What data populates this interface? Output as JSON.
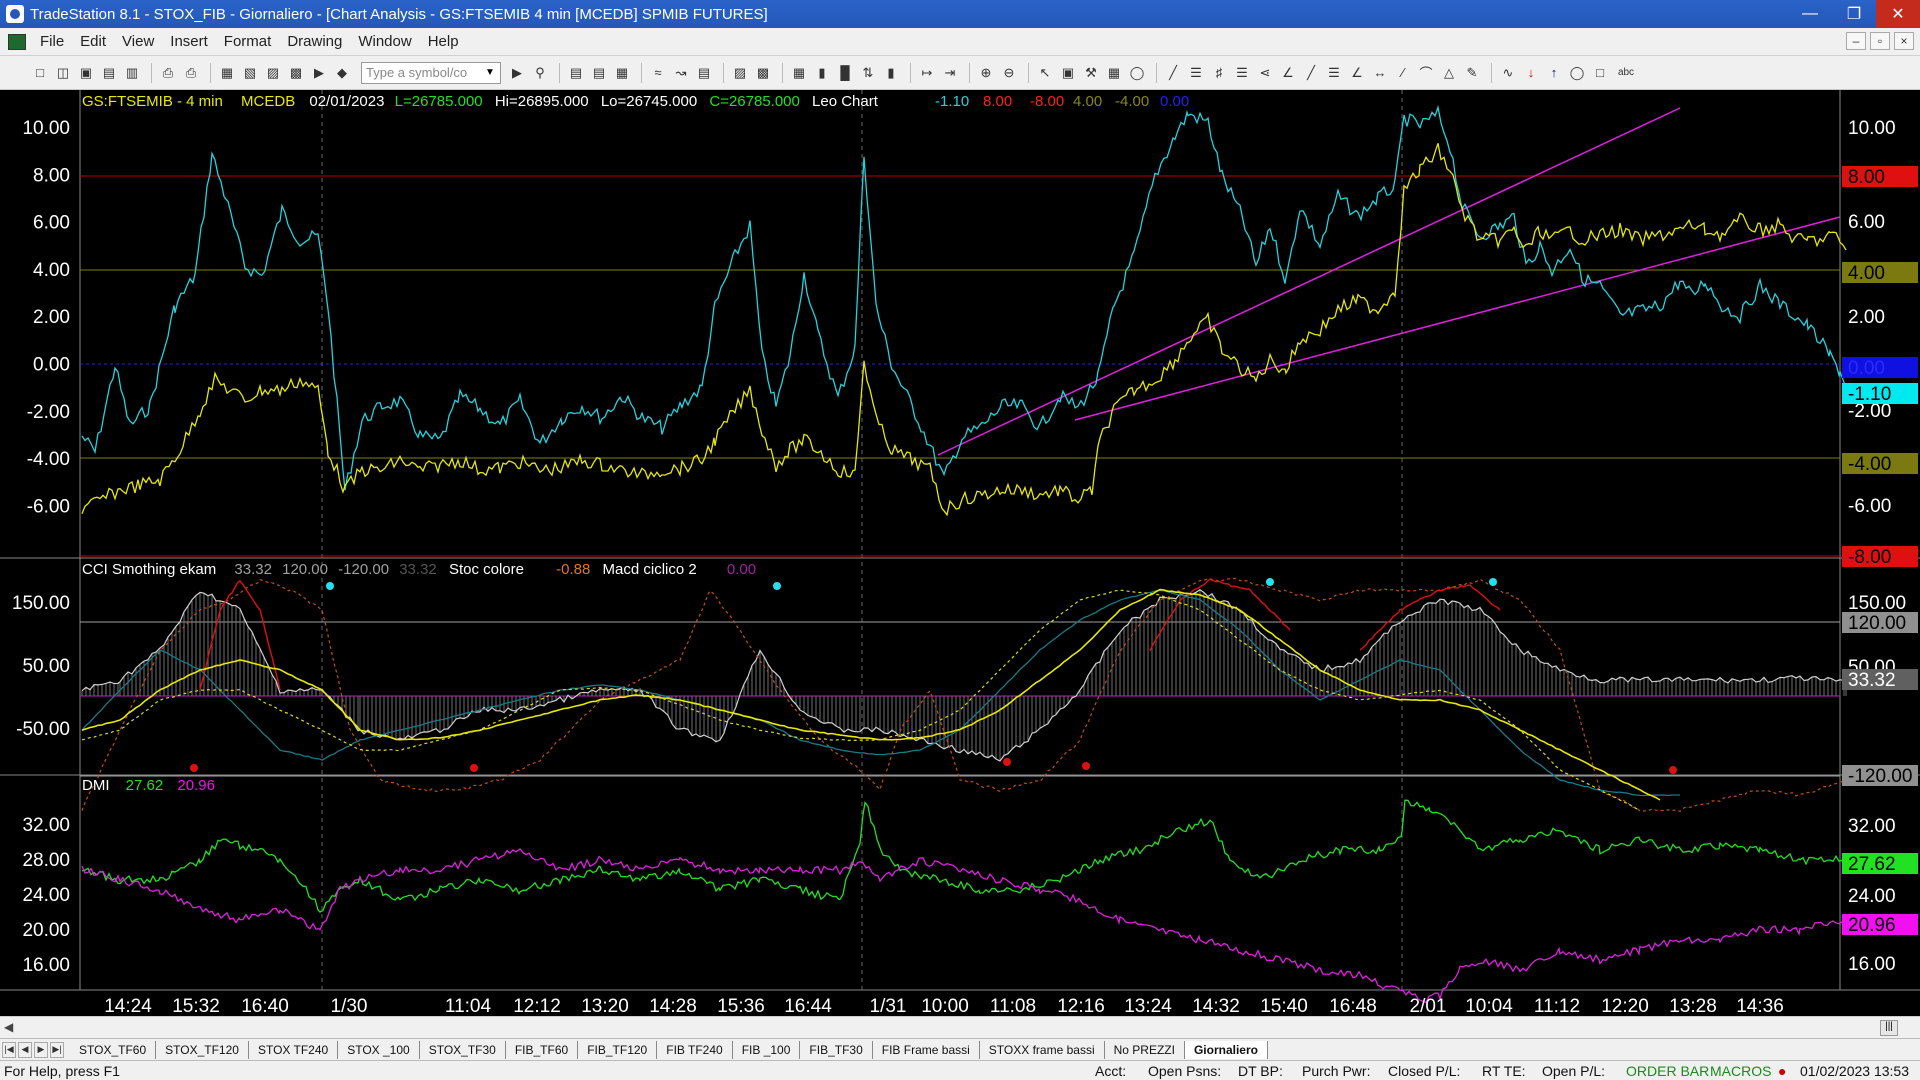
{
  "window": {
    "title": "TradeStation 8.1 - STOX_FIB - Giornaliero - [Chart Analysis - GS:FTSEMIB  4 min  [MCEDB] SPMIB FUTURES]"
  },
  "menu": [
    "File",
    "Edit",
    "View",
    "Insert",
    "Format",
    "Drawing",
    "Window",
    "Help"
  ],
  "toolbar": {
    "symbol_placeholder": "Type a symbol/co",
    "abc_label": "abc"
  },
  "chart": {
    "header": {
      "symbol": "GS:FTSEMIB - 4 min",
      "feed": "MCEDB",
      "date": "02/01/2023",
      "last": "L=26785.000",
      "high": "Hi=26895.000",
      "low": "Lo=26745.000",
      "close": "C=26785.000",
      "study": "Leo Chart",
      "values": [
        {
          "text": "-1.10",
          "color": "#22d3e0"
        },
        {
          "text": "8.00",
          "color": "#ff2020"
        },
        {
          "text": "-8.00",
          "color": "#ff2020"
        },
        {
          "text": "4.00",
          "color": "#8a8a10"
        },
        {
          "text": "-4.00",
          "color": "#8a8a10"
        },
        {
          "text": "0.00",
          "color": "#2020ff"
        }
      ]
    },
    "panel1_axis": [
      "10.00",
      "8.00",
      "6.00",
      "4.00",
      "2.00",
      "0.00",
      "-2.00",
      "-4.00",
      "-6.00"
    ],
    "panel1_right_labels": [
      {
        "text": "8.00",
        "bg": "#e01010",
        "fg": "#000"
      },
      {
        "text": "4.00",
        "bg": "#7a7a10",
        "fg": "#000"
      },
      {
        "text": "0.00",
        "bg": "#1010e0",
        "fg": "#2a2aff"
      },
      {
        "text": "-1.10",
        "bg": "#00e8f0",
        "fg": "#000"
      },
      {
        "text": "-4.00",
        "bg": "#7a7a10",
        "fg": "#000"
      },
      {
        "text": "-8.00",
        "bg": "#e01010",
        "fg": "#000"
      }
    ],
    "panel2": {
      "title": "CCI Smothing ekam",
      "v1": "33.32",
      "v2": "120.00",
      "v3": "-120.00",
      "v4": "33.32",
      "title2": "Stoc colore",
      "v5": "-0.88",
      "title3": "Macd ciclico 2",
      "v6": "0.00",
      "axis": [
        "150.00",
        "50.00",
        "-50.00"
      ],
      "right_labels": [
        {
          "text": "150.00",
          "bg": "#000",
          "fg": "#fff"
        },
        {
          "text": "120.00",
          "bg": "#909090",
          "fg": "#000"
        },
        {
          "text": "50.00",
          "bg": "#000",
          "fg": "#fff"
        },
        {
          "text": "33.32",
          "bg": "#606060",
          "fg": "#fff"
        },
        {
          "text": "-120.00",
          "bg": "#909090",
          "fg": "#000"
        }
      ]
    },
    "panel3": {
      "title": "DMI",
      "v1": "27.62",
      "v2": "20.96",
      "axis": [
        "32.00",
        "28.00",
        "24.00",
        "20.00",
        "16.00"
      ],
      "right_labels": [
        {
          "text": "32.00",
          "bg": "#000",
          "fg": "#fff"
        },
        {
          "text": "27.62",
          "bg": "#22e022",
          "fg": "#000"
        },
        {
          "text": "24.00",
          "bg": "#000",
          "fg": "#fff"
        },
        {
          "text": "20.96",
          "bg": "#f010f0",
          "fg": "#000"
        },
        {
          "text": "16.00",
          "bg": "#000",
          "fg": "#fff"
        }
      ]
    },
    "time_axis": [
      "14:24",
      "15:32",
      "16:40",
      "1/30",
      "11:04",
      "12:12",
      "13:20",
      "14:28",
      "15:36",
      "16:44",
      "1/31",
      "10:00",
      "11:08",
      "12:16",
      "13:24",
      "14:32",
      "15:40",
      "16:48",
      "2/01",
      "10:04",
      "11:12",
      "12:20",
      "13:28",
      "14:36"
    ]
  },
  "tabs": [
    "STOX_TF60",
    "STOX_TF120",
    "STOX TF240",
    "STOX _100",
    "STOX_TF30",
    "FIB_TF60",
    "FIB_TF120",
    "FIB TF240",
    "FIB _100",
    "FIB_TF30",
    "FIB Frame bassi",
    "STOXX frame bassi",
    "No PREZZI",
    "Giornaliero"
  ],
  "status": {
    "help": "For Help, press F1",
    "acct": "Acct:",
    "open_psns": "Open Psns:",
    "dt_bp": "DT BP:",
    "purch_pwr": "Purch Pwr:",
    "closed_pl": "Closed P/L:",
    "rt_te": "RT TE:",
    "open_pl": "Open P/L:",
    "order_bar": "ORDER BAR",
    "macros": "MACROS",
    "datetime": "01/02/2023 13:53"
  }
}
